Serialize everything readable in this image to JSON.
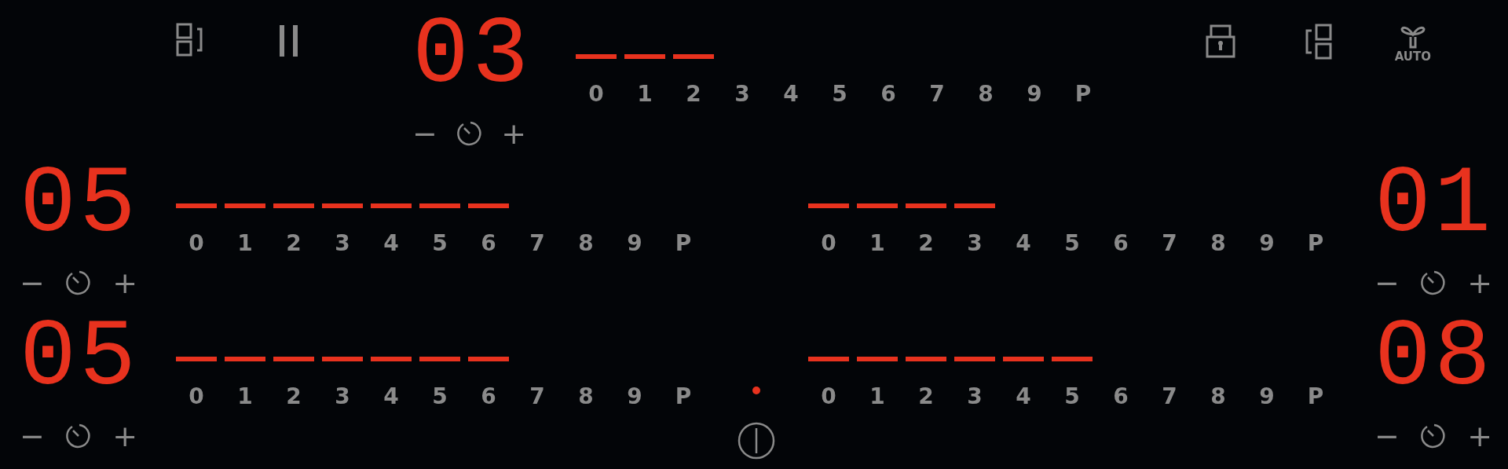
{
  "hood_label": "AUTO",
  "top_zone": {
    "display": "03",
    "minus": "−",
    "plus": "+",
    "steps": [
      {
        "label": "0",
        "lit": true
      },
      {
        "label": "1",
        "lit": true
      },
      {
        "label": "2",
        "lit": true
      },
      {
        "label": "3",
        "lit": false
      },
      {
        "label": "4",
        "lit": false
      },
      {
        "label": "5",
        "lit": false
      },
      {
        "label": "6",
        "lit": false
      },
      {
        "label": "7",
        "lit": false
      },
      {
        "label": "8",
        "lit": false
      },
      {
        "label": "9",
        "lit": false
      },
      {
        "label": "P",
        "lit": false
      }
    ]
  },
  "rows": [
    {
      "left_zone": {
        "display": "05",
        "minus": "−",
        "plus": "+",
        "steps": [
          {
            "label": "0",
            "lit": true
          },
          {
            "label": "1",
            "lit": true
          },
          {
            "label": "2",
            "lit": true
          },
          {
            "label": "3",
            "lit": true
          },
          {
            "label": "4",
            "lit": true
          },
          {
            "label": "5",
            "lit": true
          },
          {
            "label": "6",
            "lit": true
          },
          {
            "label": "7",
            "lit": false
          },
          {
            "label": "8",
            "lit": false
          },
          {
            "label": "9",
            "lit": false
          },
          {
            "label": "P",
            "lit": false
          }
        ]
      },
      "right_zone": {
        "display": "01",
        "minus": "−",
        "plus": "+",
        "steps": [
          {
            "label": "0",
            "lit": true
          },
          {
            "label": "1",
            "lit": true
          },
          {
            "label": "2",
            "lit": true
          },
          {
            "label": "3",
            "lit": true
          },
          {
            "label": "4",
            "lit": false
          },
          {
            "label": "5",
            "lit": false
          },
          {
            "label": "6",
            "lit": false
          },
          {
            "label": "7",
            "lit": false
          },
          {
            "label": "8",
            "lit": false
          },
          {
            "label": "9",
            "lit": false
          },
          {
            "label": "P",
            "lit": false
          }
        ]
      }
    },
    {
      "left_zone": {
        "display": "05",
        "minus": "−",
        "plus": "+",
        "steps": [
          {
            "label": "0",
            "lit": true
          },
          {
            "label": "1",
            "lit": true
          },
          {
            "label": "2",
            "lit": true
          },
          {
            "label": "3",
            "lit": true
          },
          {
            "label": "4",
            "lit": true
          },
          {
            "label": "5",
            "lit": true
          },
          {
            "label": "6",
            "lit": true
          },
          {
            "label": "7",
            "lit": false
          },
          {
            "label": "8",
            "lit": false
          },
          {
            "label": "9",
            "lit": false
          },
          {
            "label": "P",
            "lit": false
          }
        ]
      },
      "right_zone": {
        "display": "08",
        "minus": "−",
        "plus": "+",
        "steps": [
          {
            "label": "0",
            "lit": true
          },
          {
            "label": "1",
            "lit": true
          },
          {
            "label": "2",
            "lit": true
          },
          {
            "label": "3",
            "lit": true
          },
          {
            "label": "4",
            "lit": true
          },
          {
            "label": "5",
            "lit": true
          },
          {
            "label": "6",
            "lit": false
          },
          {
            "label": "7",
            "lit": false
          },
          {
            "label": "8",
            "lit": false
          },
          {
            "label": "9",
            "lit": false
          },
          {
            "label": "P",
            "lit": false
          }
        ]
      }
    }
  ],
  "power": {
    "indicator_on": true
  }
}
